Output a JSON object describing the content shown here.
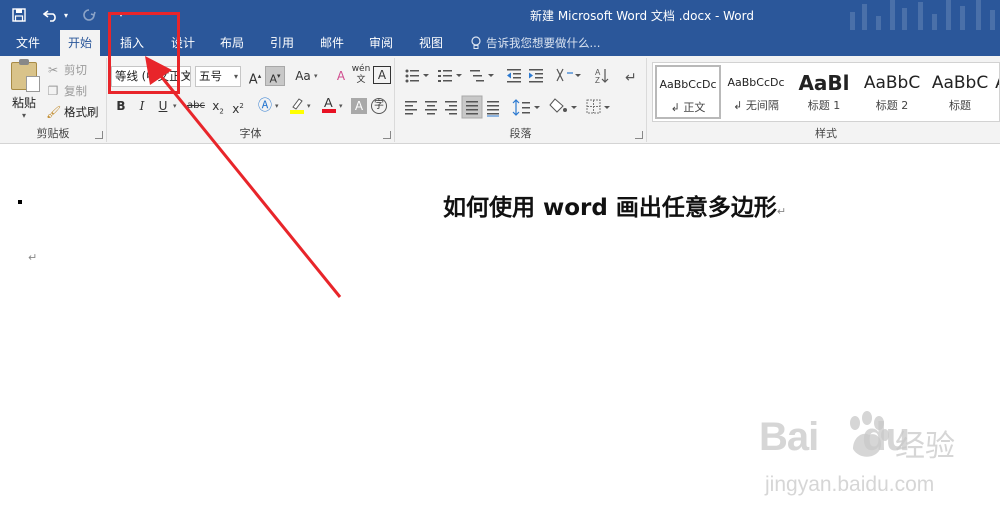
{
  "window": {
    "title": "新建 Microsoft Word 文档 .docx - Word"
  },
  "quick_access": {
    "save_icon": "save-icon",
    "undo_icon": "undo-icon",
    "redo_icon": "redo-icon",
    "customize_icon": "customize-qat-icon"
  },
  "tabs": [
    {
      "label": "文件"
    },
    {
      "label": "开始",
      "active": true
    },
    {
      "label": "插入"
    },
    {
      "label": "设计"
    },
    {
      "label": "布局"
    },
    {
      "label": "引用"
    },
    {
      "label": "邮件"
    },
    {
      "label": "审阅"
    },
    {
      "label": "视图"
    }
  ],
  "tell_me": {
    "placeholder": "告诉我您想要做什么..."
  },
  "ribbon": {
    "clipboard": {
      "label": "剪贴板",
      "paste": "粘贴",
      "cut": "剪切",
      "copy": "复制",
      "format_painter": "格式刷"
    },
    "font": {
      "label": "字体",
      "font_name": "等线 (中文正文",
      "font_size": "五号",
      "grow": "A",
      "shrink": "A",
      "change_case": "Aa",
      "clear": "A",
      "bold": "B",
      "italic": "I",
      "underline": "U",
      "strikethrough": "abc",
      "subscript": "x",
      "superscript": "x",
      "phonetic": "wén",
      "char_border": "A",
      "char_shading": "A",
      "enclose": "字",
      "font_color_hex": "#e81123",
      "highlight_color_hex": "#ffff00"
    },
    "paragraph": {
      "label": "段落"
    },
    "styles": {
      "label": "样式",
      "items": [
        {
          "preview": "AaBbCcDc",
          "name": "↲ 正文"
        },
        {
          "preview": "AaBbCcDc",
          "name": "↲ 无间隔"
        },
        {
          "preview": "AaBl",
          "name": "标题 1"
        },
        {
          "preview": "AaBbC",
          "name": "标题 2"
        },
        {
          "preview": "AaBbC",
          "name": "标题"
        },
        {
          "preview": "A",
          "name": ""
        }
      ]
    }
  },
  "document": {
    "heading": "如何使用 word 画出任意多边形",
    "paragraph_mark": "↵"
  },
  "annotation": {
    "color_hex": "#e8252a"
  },
  "watermark": {
    "brand": "Bai",
    "brand_tail": "du",
    "brand_cn": "经验",
    "url": "jingyan.baidu.com"
  }
}
